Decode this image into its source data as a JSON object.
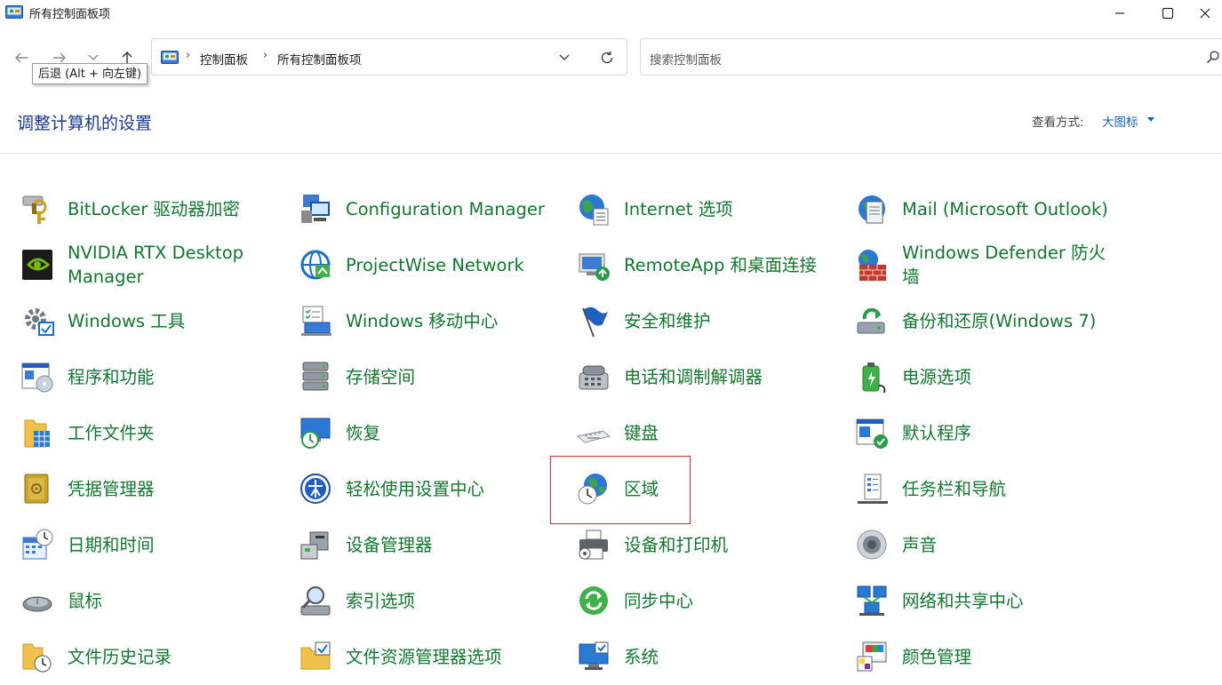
{
  "window": {
    "title": "所有控制面板项",
    "controls": [
      "minimize",
      "maximize",
      "close"
    ]
  },
  "navigation": {
    "tooltip": "后退 (Alt + 向左键)",
    "breadcrumb": [
      "控制面板",
      "所有控制面板项"
    ],
    "search_placeholder": "搜索控制面板"
  },
  "header": {
    "title": "调整计算机的设置",
    "view_label": "查看方式:",
    "view_value": "大图标"
  },
  "items": [
    {
      "label": "BitLocker 驱动器加密",
      "icon": "bitlocker-icon"
    },
    {
      "label": "Configuration Manager",
      "icon": "configuration-manager-icon"
    },
    {
      "label": "Internet 选项",
      "icon": "internet-options-icon"
    },
    {
      "label": "Mail (Microsoft Outlook)",
      "icon": "mail-icon"
    },
    {
      "label": "NVIDIA RTX Desktop Manager",
      "icon": "nvidia-icon"
    },
    {
      "label": "ProjectWise  Network",
      "icon": "projectwise-icon"
    },
    {
      "label": "RemoteApp 和桌面连接",
      "icon": "remoteapp-icon"
    },
    {
      "label": "Windows Defender 防火墙",
      "icon": "firewall-icon"
    },
    {
      "label": "Windows 工具",
      "icon": "windows-tools-icon"
    },
    {
      "label": "Windows 移动中心",
      "icon": "mobility-center-icon"
    },
    {
      "label": "安全和维护",
      "icon": "security-flag-icon"
    },
    {
      "label": "备份和还原(Windows 7)",
      "icon": "backup-icon"
    },
    {
      "label": "程序和功能",
      "icon": "programs-icon"
    },
    {
      "label": "存储空间",
      "icon": "storage-icon"
    },
    {
      "label": "电话和调制解调器",
      "icon": "phone-modem-icon"
    },
    {
      "label": "电源选项",
      "icon": "power-icon"
    },
    {
      "label": "工作文件夹",
      "icon": "work-folders-icon"
    },
    {
      "label": "恢复",
      "icon": "recovery-icon"
    },
    {
      "label": "键盘",
      "icon": "keyboard-icon"
    },
    {
      "label": "默认程序",
      "icon": "default-programs-icon"
    },
    {
      "label": "凭据管理器",
      "icon": "credential-icon"
    },
    {
      "label": "轻松使用设置中心",
      "icon": "ease-of-access-icon"
    },
    {
      "label": "区域",
      "icon": "region-icon"
    },
    {
      "label": "任务栏和导航",
      "icon": "taskbar-icon"
    },
    {
      "label": "日期和时间",
      "icon": "date-time-icon"
    },
    {
      "label": "设备管理器",
      "icon": "device-manager-icon"
    },
    {
      "label": "设备和打印机",
      "icon": "printer-icon"
    },
    {
      "label": "声音",
      "icon": "sound-icon"
    },
    {
      "label": "鼠标",
      "icon": "mouse-icon"
    },
    {
      "label": "索引选项",
      "icon": "indexing-icon"
    },
    {
      "label": "同步中心",
      "icon": "sync-icon"
    },
    {
      "label": "网络和共享中心",
      "icon": "network-icon"
    },
    {
      "label": "文件历史记录",
      "icon": "file-history-icon"
    },
    {
      "label": "文件资源管理器选项",
      "icon": "explorer-options-icon"
    },
    {
      "label": "系统",
      "icon": "system-icon"
    },
    {
      "label": "颜色管理",
      "icon": "color-management-icon"
    }
  ],
  "highlighted_item": "区域",
  "colors": {
    "item_text": "#12772f",
    "title_text": "#1a3a8f",
    "link": "#1a5fb4",
    "highlight_border": "#d42b2b"
  }
}
